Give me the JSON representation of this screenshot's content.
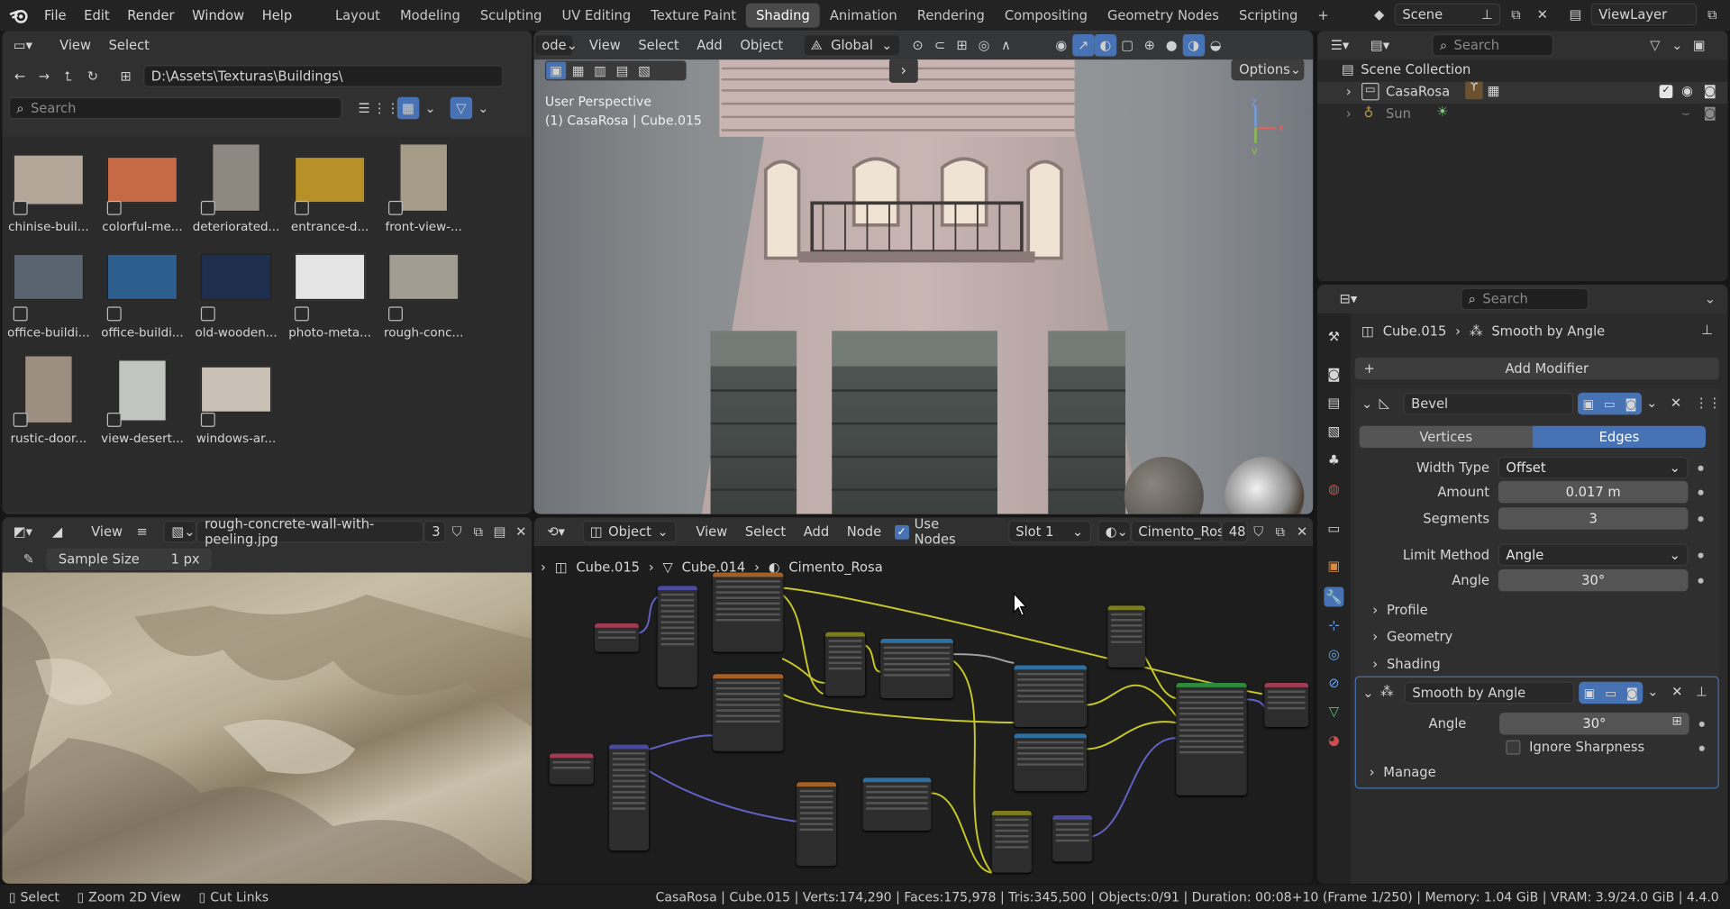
{
  "topbar": {
    "menus": [
      "File",
      "Edit",
      "Render",
      "Window",
      "Help"
    ],
    "workspaces": [
      "Layout",
      "Modeling",
      "Sculpting",
      "UV Editing",
      "Texture Paint",
      "Shading",
      "Animation",
      "Rendering",
      "Compositing",
      "Geometry Nodes",
      "Scripting"
    ],
    "active_workspace": "Shading",
    "scene": "Scene",
    "view_layer": "ViewLayer"
  },
  "file_browser": {
    "menus": [
      "View",
      "Select"
    ],
    "path": "D:\\Assets\\Texturas\\Buildings\\",
    "search_placeholder": "Search",
    "files": [
      {
        "name": "chinise-buil...",
        "color": "#b4a79a"
      },
      {
        "name": "colorful-me...",
        "color": "#c66a45"
      },
      {
        "name": "deteriorated...",
        "color": "#8f8880"
      },
      {
        "name": "entrance-d...",
        "color": "#b89028"
      },
      {
        "name": "front-view-...",
        "color": "#a59c88"
      },
      {
        "name": "office-buildi...",
        "color": "#5a6470"
      },
      {
        "name": "office-buildi...",
        "color": "#2c5f8e"
      },
      {
        "name": "old-wooden...",
        "color": "#1f2e4c"
      },
      {
        "name": "photo-meta...",
        "color": "#e4e4e4"
      },
      {
        "name": "rough-conc...",
        "color": "#a29d92"
      },
      {
        "name": "rustic-door...",
        "color": "#9c8f82"
      },
      {
        "name": "view-desert...",
        "color": "#c2c4c2"
      },
      {
        "name": "windows-ar...",
        "color": "#c9c1b5"
      }
    ]
  },
  "viewport": {
    "mode_label": "ode",
    "menus": [
      "View",
      "Select",
      "Add",
      "Object"
    ],
    "transform": "Global",
    "options": "Options",
    "overlay_title": "User Perspective",
    "overlay_sub": "(1) CasaRosa | Cube.015",
    "axes": {
      "z": "z",
      "x": "x",
      "y": "y"
    }
  },
  "image_editor": {
    "view": "View",
    "image_name": "rough-concrete-wall-with-peeling.jpg",
    "users": "3",
    "sample_label": "Sample Size",
    "sample_value": "1 px"
  },
  "node_editor": {
    "object_mode": "Object",
    "menus": [
      "View",
      "Select",
      "Add",
      "Node"
    ],
    "use_nodes": "Use Nodes",
    "slot": "Slot 1",
    "material": "Cimento_Rosa",
    "material_users": "48",
    "breadcrumb": [
      "Cube.015",
      "Cube.014",
      "Cimento_Rosa"
    ]
  },
  "outliner": {
    "search_placeholder": "Search",
    "collection": "Scene Collection",
    "items": [
      {
        "name": "CasaRosa"
      },
      {
        "name": "Sun"
      }
    ]
  },
  "properties": {
    "search_placeholder": "Search",
    "breadcrumb_object": "Cube.015",
    "breadcrumb_modifier": "Smooth by Angle",
    "add_modifier": "Add Modifier",
    "bevel": {
      "name": "Bevel",
      "tabs": [
        "Vertices",
        "Edges"
      ],
      "active_tab": "Edges",
      "width_type_label": "Width Type",
      "width_type": "Offset",
      "amount_label": "Amount",
      "amount": "0.017 m",
      "segments_label": "Segments",
      "segments": "3",
      "limit_label": "Limit Method",
      "limit": "Angle",
      "angle_label": "Angle",
      "angle": "30°",
      "subpanels": [
        "Profile",
        "Geometry",
        "Shading"
      ]
    },
    "smooth": {
      "name": "Smooth by Angle",
      "angle_label": "Angle",
      "angle": "30°",
      "ignore_label": "Ignore Sharpness",
      "manage": "Manage"
    }
  },
  "statusbar": {
    "hints": [
      "Select",
      "Zoom 2D View",
      "Cut Links"
    ],
    "stats": "CasaRosa | Cube.015 | Verts:174,290 | Faces:175,978 | Tris:345,500 | Objects:0/91 | Duration: 00:08+10 (Frame 1/250) | Memory: 1.04 GiB | VRAM: 3.9/24.0 GiB | 4.4.0"
  }
}
